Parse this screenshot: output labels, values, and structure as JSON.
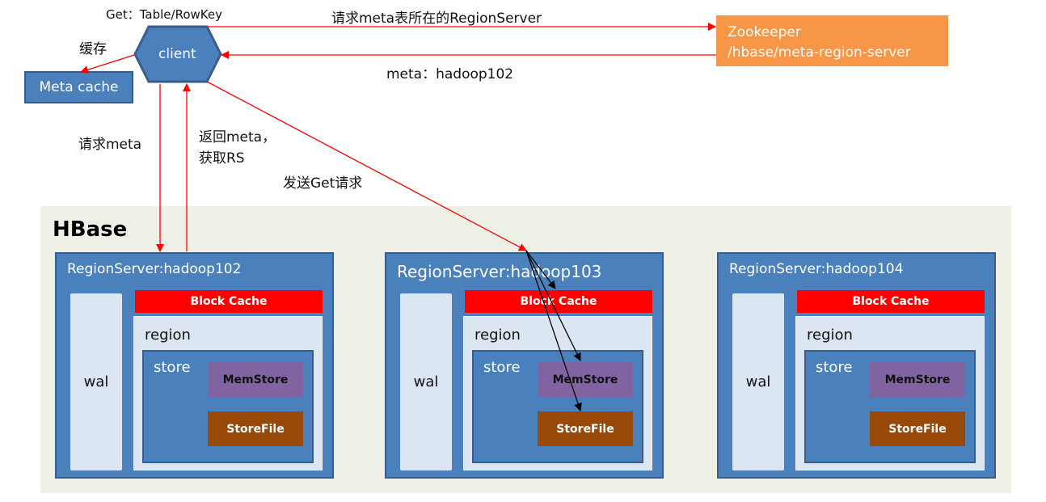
{
  "client": {
    "label": "client",
    "request": "Get：Table/RowKey"
  },
  "meta_cache": {
    "label": "Meta cache",
    "arrow_label": "缓存"
  },
  "zookeeper": {
    "line1": "Zookeeper",
    "line2": "/hbase/meta-region-server"
  },
  "edges": {
    "ask_zk": "请求meta表所在的RegionServer",
    "zk_reply": "meta：hadoop102",
    "request_meta": "请求meta",
    "return_meta_1": "返回meta，",
    "return_meta_2": "获取RS",
    "send_get": "发送Get请求"
  },
  "hbase": {
    "title": "HBase",
    "servers": [
      {
        "title": "RegionServer:hadoop102",
        "wal": "wal",
        "block_cache": "Block Cache",
        "region": "region",
        "store": "store",
        "memstore": "MemStore",
        "storefile": "StoreFile"
      },
      {
        "title": "RegionServer:hadoop103",
        "wal": "wal",
        "block_cache": "Block Cache",
        "region": "region",
        "store": "store",
        "memstore": "MemStore",
        "storefile": "StoreFile"
      },
      {
        "title": "RegionServer:hadoop104",
        "wal": "wal",
        "block_cache": "Block Cache",
        "region": "region",
        "store": "store",
        "memstore": "MemStore",
        "storefile": "StoreFile"
      }
    ]
  },
  "colors": {
    "primary": "#4A81BD",
    "zookeeper": "#F79646",
    "block_cache": "#FF0000",
    "memstore": "#8064A2",
    "storefile": "#984807",
    "arrow": "#FF0000",
    "background": "#EEF0E6"
  }
}
